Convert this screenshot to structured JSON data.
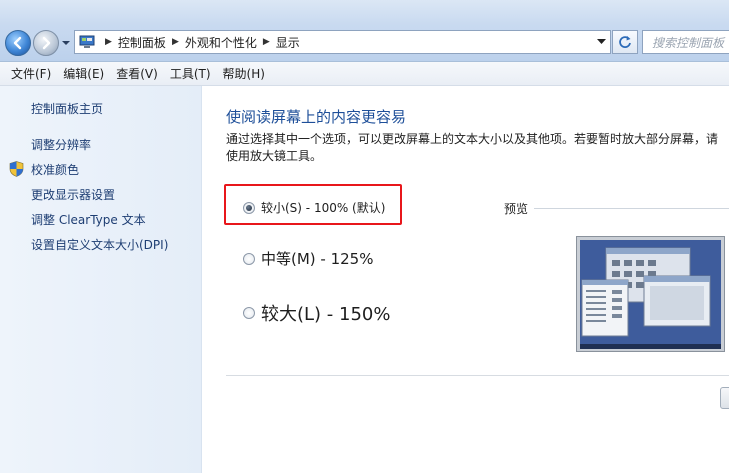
{
  "address_bar": {
    "crumbs": [
      "控制面板",
      "外观和个性化",
      "显示"
    ],
    "search_placeholder": "搜索控制面板"
  },
  "menu": [
    "文件(F)",
    "编辑(E)",
    "查看(V)",
    "工具(T)",
    "帮助(H)"
  ],
  "left_nav": {
    "home": "控制面板主页",
    "links": [
      "调整分辨率",
      "校准颜色",
      "更改显示器设置",
      "调整 ClearType 文本",
      "设置自定义文本大小(DPI)"
    ]
  },
  "main": {
    "heading": "使阅读屏幕上的内容更容易",
    "description": "通过选择其中一个选项，可以更改屏幕上的文本大小以及其他项。若要暂时放大部分屏幕，请使用放大镜工具。",
    "options": [
      {
        "label": "较小(S) - 100% (默认)",
        "selected": true
      },
      {
        "label": "中等(M) - 125%",
        "selected": false
      },
      {
        "label": "较大(L) - 150%",
        "selected": false
      }
    ],
    "preview_label": "预览"
  },
  "colors": {
    "link": "#1e3e73",
    "heading": "#1e4f99",
    "highlight": "#e8161b"
  }
}
